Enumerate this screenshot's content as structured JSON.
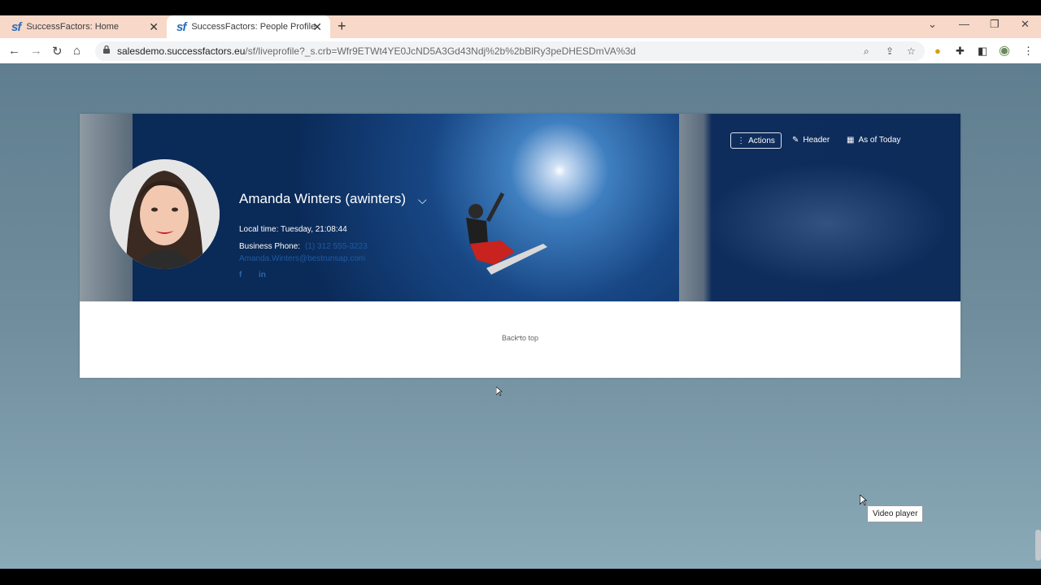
{
  "browser": {
    "tabs": [
      {
        "icon": "sf",
        "title": "SuccessFactors: Home"
      },
      {
        "icon": "sf",
        "title": "SuccessFactors: People Profile"
      }
    ],
    "url_host": "salesdemo.successfactors.eu",
    "url_path": "/sf/liveprofile?_s.crb=Wfr9ETWt4YE0JcND5A3Gd43Ndj%2b%2bBlRy3peDHESDmVA%3d"
  },
  "profile": {
    "name": "Amanda Winters (awinters)",
    "local_time": "Local time: Tuesday, 21:08:44",
    "phone_label": "Business Phone:",
    "phone_value": "(1) 312 555-3223",
    "email": "Amanda.Winters@bestrunsap.com",
    "social": [
      "f",
      "in"
    ]
  },
  "header_actions": {
    "actions": "Actions",
    "header": "Header",
    "as_of_today": "As of Today"
  },
  "footer": {
    "back_to_top": "Back to top"
  },
  "tooltip": "Video player",
  "colors": {
    "tabstrip": "#f8d8c8",
    "banner": "#0c2d5a",
    "page_bg": "#6f8d9c",
    "link": "#1f5aa0"
  }
}
